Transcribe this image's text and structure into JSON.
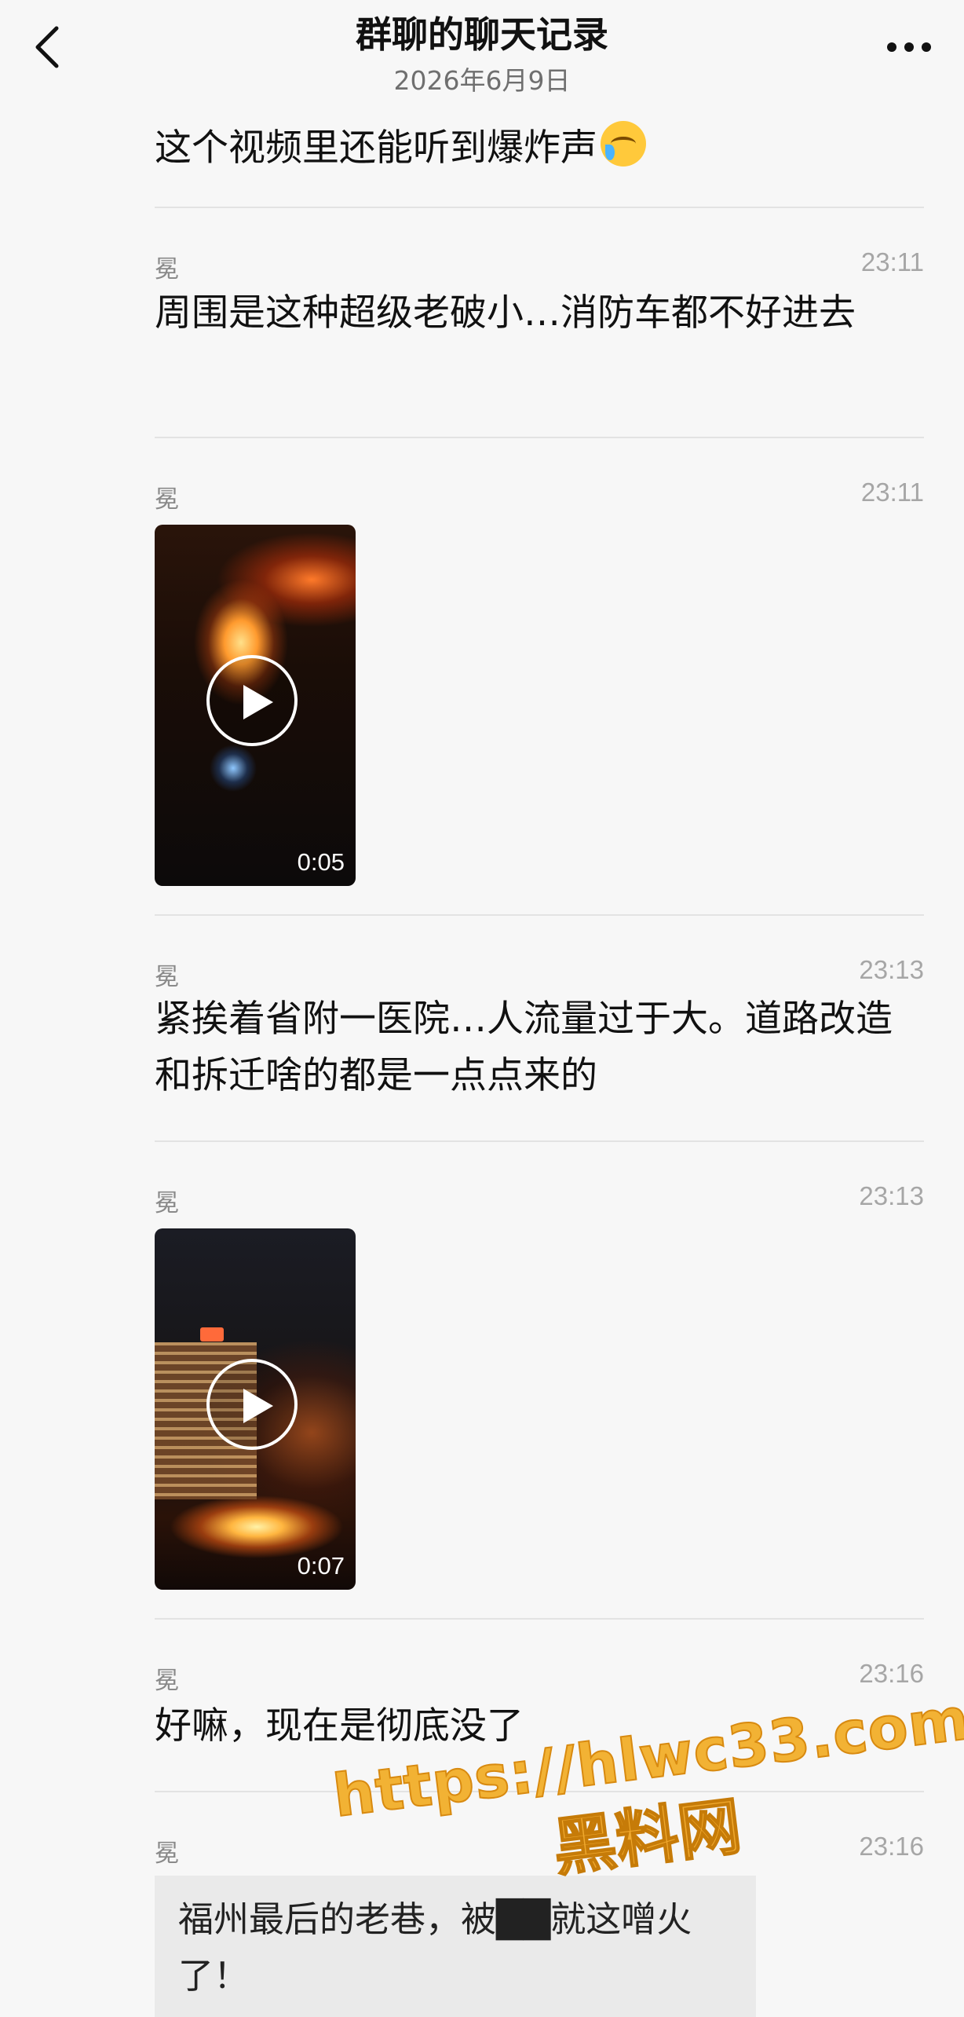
{
  "header": {
    "title": "群聊的聊天记录",
    "date": "2026年6月9日"
  },
  "messages": [
    {
      "type": "text",
      "text": "这个视频里还能听到爆炸声",
      "emoji": "crying-face-icon"
    },
    {
      "type": "text",
      "sender": "冕",
      "time": "23:11",
      "text": "周围是这种超级老破小…消防车都不好进去"
    },
    {
      "type": "video",
      "sender": "冕",
      "time": "23:11",
      "duration": "0:05",
      "thumbnail": "night-fire-trees"
    },
    {
      "type": "text",
      "sender": "冕",
      "time": "23:13",
      "text": "紧挨着省附一医院…人流量过于大。道路改造和拆迁啥的都是一点点来的"
    },
    {
      "type": "video",
      "sender": "冕",
      "time": "23:13",
      "duration": "0:07",
      "thumbnail": "fire-near-hospital-building"
    },
    {
      "type": "text",
      "sender": "冕",
      "time": "23:16",
      "text": "好嘛，现在是彻底没了"
    },
    {
      "type": "quote",
      "sender": "冕",
      "time": "23:16",
      "text": "福州最后的老巷，被██就这噌火了！"
    }
  ],
  "watermark": {
    "url": "https://hlwc33.com",
    "name": "黑料网"
  },
  "colors": {
    "background": "#f7f7f7",
    "divider": "#e3e3e3",
    "meta_text": "#a6a6a6",
    "watermark": "#f2b234"
  }
}
